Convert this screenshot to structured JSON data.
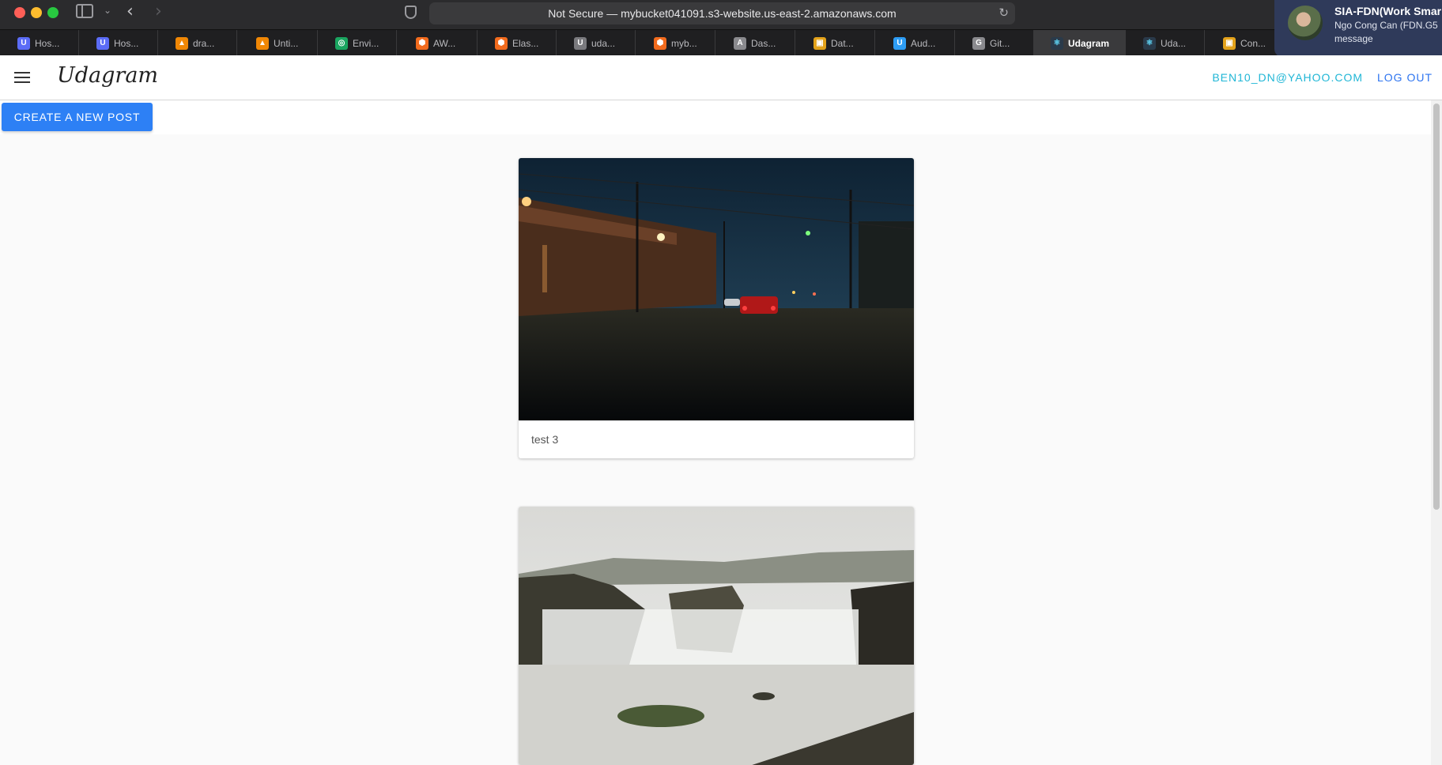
{
  "browser": {
    "url": "Not Secure — mybucket041091.s3-website.us-east-2.amazonaws.com",
    "tabs": [
      {
        "label": "Hos...",
        "icon": "udacity-icon",
        "color": "#5b6cf7"
      },
      {
        "label": "Hos...",
        "icon": "udacity-icon",
        "color": "#5b6cf7"
      },
      {
        "label": "dra...",
        "icon": "drawio-icon",
        "color": "#f08705"
      },
      {
        "label": "Unti...",
        "icon": "drawio-icon",
        "color": "#f08705"
      },
      {
        "label": "Envi...",
        "icon": "circleci-icon",
        "color": "#1aa560"
      },
      {
        "label": "AW...",
        "icon": "aws-cube-icon",
        "color": "#f26b1d"
      },
      {
        "label": "Elas...",
        "icon": "aws-cube-icon",
        "color": "#f26b1d"
      },
      {
        "label": "uda...",
        "icon": "letter-u-icon",
        "color": "#7a7a7e"
      },
      {
        "label": "myb...",
        "icon": "aws-cube-icon",
        "color": "#f26b1d"
      },
      {
        "label": "Das...",
        "icon": "letter-a-icon",
        "color": "#8a8a8e"
      },
      {
        "label": "Dat...",
        "icon": "box-icon",
        "color": "#e3a21a"
      },
      {
        "label": "Aud...",
        "icon": "udacity-icon",
        "color": "#2d9df5"
      },
      {
        "label": "Git...",
        "icon": "letter-g-icon",
        "color": "#8a8a8e"
      },
      {
        "label": "Udagram",
        "icon": "react-icon",
        "color": "#61dafb",
        "active": true
      },
      {
        "label": "Uda...",
        "icon": "react-icon",
        "color": "#61dafb"
      },
      {
        "label": "Con...",
        "icon": "box-icon",
        "color": "#e3a21a"
      }
    ]
  },
  "notification": {
    "title": "SIA-FDN(Work Smar",
    "sender": "Ngo Cong Can (FDN.G5",
    "body": "message"
  },
  "app": {
    "brand": "Udagram",
    "user_email": "BEN10_DN@YAHOO.COM",
    "logout_label": "LOG OUT",
    "create_post_label": "CREATE A NEW POST"
  },
  "feed": {
    "posts": [
      {
        "caption": "test 3",
        "image": "night street photo"
      },
      {
        "caption": "",
        "image": "waterfall photo"
      }
    ]
  }
}
